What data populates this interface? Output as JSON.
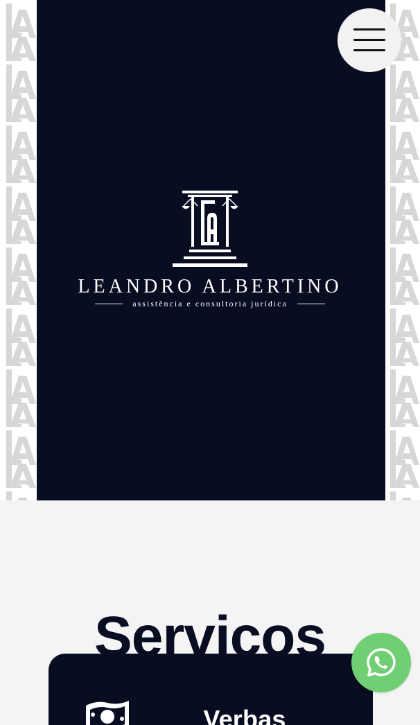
{
  "hero": {
    "brand_name": "LEANDRO ALBERTINO",
    "brand_tagline": "assistência e consultoria jurídica",
    "menu_icon": "hamburger-menu-icon",
    "pattern_icon": "la-monogram-pattern-icon",
    "colors": {
      "panel": "#080d21",
      "menu_button": "#f2f2f2",
      "pattern": "#d7d7d7"
    }
  },
  "services": {
    "heading": "Serviços",
    "cards": [
      {
        "title": "Verbas Rescisórias",
        "icon": "money-bill-icon"
      }
    ]
  },
  "floating_actions": {
    "whatsapp_icon": "whatsapp-icon",
    "whatsapp_color": "#6fcf72"
  },
  "colors": {
    "page_background": "#f4f4f5",
    "text_dark": "#080d21",
    "text_light": "#ffffff"
  }
}
